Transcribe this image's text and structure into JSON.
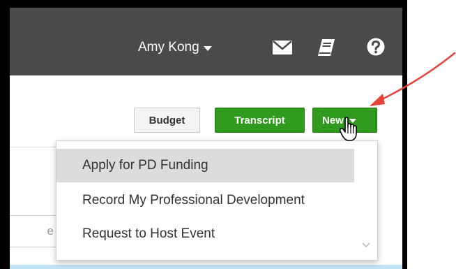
{
  "header": {
    "user_name": "Amy Kong",
    "icons": [
      "mail-icon",
      "book-icon",
      "help-icon"
    ]
  },
  "toolbar": {
    "budget_label": "Budget",
    "transcript_label": "Transcript",
    "new_label": "New"
  },
  "new_menu": {
    "items": [
      {
        "label": "Apply for PD Funding",
        "hovered": true
      },
      {
        "label": "Record My Professional Development",
        "hovered": false
      },
      {
        "label": "Request to Host Event",
        "hovered": false
      }
    ]
  },
  "background": {
    "search_placeholder_fragment": "e"
  },
  "colors": {
    "header_bg": "#4a4a4a",
    "primary_green": "#2f9a1e",
    "hover_gray": "#dcdcdc",
    "annotation_red": "#e8433b",
    "info_strip": "#bfe4f3"
  }
}
